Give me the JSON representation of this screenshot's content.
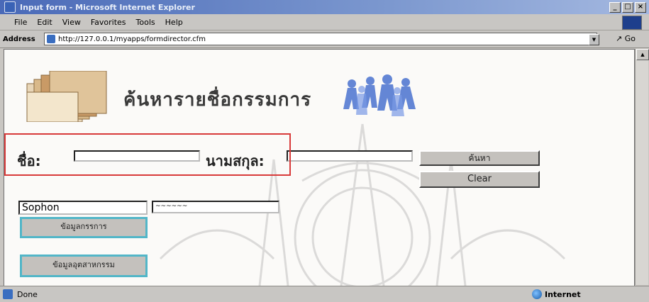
{
  "window": {
    "title": "Input form - Microsoft Internet Explorer",
    "controls": [
      "_",
      "□",
      "×"
    ]
  },
  "menu": [
    "File",
    "Edit",
    "View",
    "Favorites",
    "Tools",
    "Help"
  ],
  "address": {
    "label": "Address",
    "url": "http://127.0.0.1/myapps/formdirector.cfm",
    "go_label": "Go"
  },
  "page": {
    "heading": "ค้นหารายชื่อกรรมการ",
    "first_name_label": "ชื่อ:",
    "last_name_label": "นามสกุล:",
    "first_name_value": "",
    "last_name_value": "",
    "search_button": "ค้นหา",
    "clear_button": "Clear",
    "result_first_value": "Sophon",
    "result_last_value": "~~~~~~",
    "info_button_1": "ข้อมูลกรรการ",
    "info_button_2": "ข้อมูลอุตสาหกรรม"
  },
  "status": {
    "text": "Done",
    "zone": "Internet"
  },
  "colors": {
    "titlebar": "#4a6ab8",
    "highlight": "#d83a3a",
    "cyan_button_border": "#52b6c8"
  },
  "icons": [
    "ie-page-icon",
    "folder-icon",
    "people-icon",
    "globe-icon",
    "ie-logo-icon"
  ]
}
